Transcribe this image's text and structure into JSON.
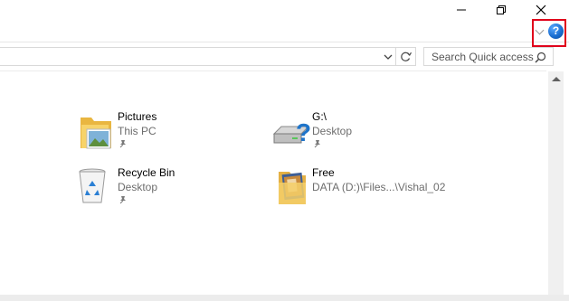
{
  "window": {
    "minimize_icon": "minimize-icon",
    "restore_icon": "restore-icon",
    "close_icon": "close-icon"
  },
  "ribbon": {
    "help_glyph": "?",
    "help_color": "#1c6fd1",
    "highlight_color": "#e0001b"
  },
  "address": {
    "dropdown_icon": "chevron-down-icon",
    "refresh_icon": "refresh-icon"
  },
  "search": {
    "placeholder": "Search Quick access",
    "icon": "search-icon"
  },
  "quick_access": [
    {
      "name": "Pictures",
      "location": "This PC",
      "icon": "pictures-folder-icon"
    },
    {
      "name": "G:\\",
      "location": "Desktop",
      "icon": "unknown-drive-icon"
    },
    {
      "name": "Recycle Bin",
      "location": "Desktop",
      "icon": "recycle-bin-icon"
    },
    {
      "name": "Free",
      "location": "DATA (D:)\\Files...\\Vishal_02",
      "icon": "photo-folder-icon"
    }
  ]
}
